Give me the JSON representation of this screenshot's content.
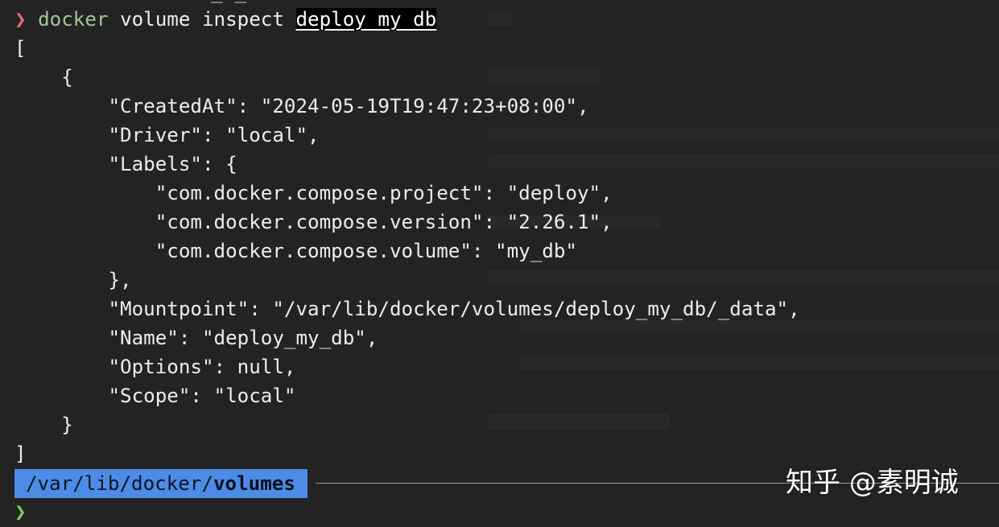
{
  "terminal": {
    "previous_line_partial": "                  _ _",
    "command": {
      "prompt_symbol": "❯",
      "program": "docker",
      "subcommand": "volume inspect",
      "argument": "deploy_my_db"
    },
    "output": [
      "[",
      "    {",
      "        \"CreatedAt\": \"2024-05-19T19:47:23+08:00\",",
      "        \"Driver\": \"local\",",
      "        \"Labels\": {",
      "            \"com.docker.compose.project\": \"deploy\",",
      "            \"com.docker.compose.version\": \"2.26.1\",",
      "            \"com.docker.compose.volume\": \"my_db\"",
      "        },",
      "        \"Mountpoint\": \"/var/lib/docker/volumes/deploy_my_db/_data\",",
      "        \"Name\": \"deploy_my_db\",",
      "        \"Options\": null,",
      "        \"Scope\": \"local\"",
      "    }",
      "]"
    ],
    "cwd": {
      "parent": "/var/lib/docker/",
      "current": "volumes"
    },
    "next_prompt_symbol": "❯"
  },
  "watermark": "知乎 @素明诚",
  "colors": {
    "background": "#232323",
    "prompt_error": "#e46f6f",
    "prompt_ok": "#6fd05a",
    "command": "#9ec992",
    "path_bar": "#4c8ce6"
  }
}
